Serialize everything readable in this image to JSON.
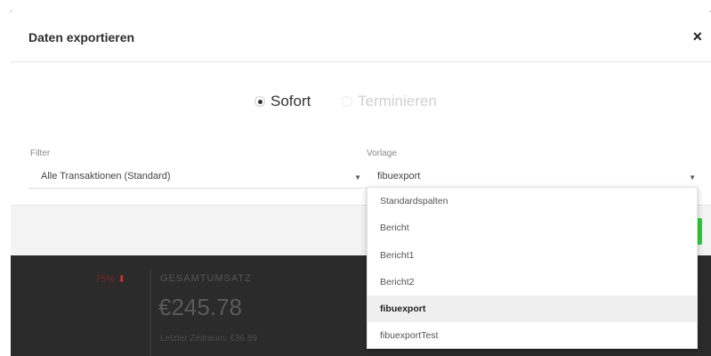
{
  "background": {
    "kpi_change": "75%",
    "kpi_label": "GESAMTUMSATZ",
    "kpi_value": "€245.78",
    "kpi_sub": "Letzter Zeitraum: €36.89"
  },
  "modal": {
    "title": "Daten exportieren",
    "close_symbol": "×",
    "modes": [
      {
        "label": "Sofort",
        "checked": true
      },
      {
        "label": "Terminieren",
        "checked": false
      }
    ],
    "filter": {
      "label": "Filter",
      "value": "Alle Transaktionen (Standard)"
    },
    "template": {
      "label": "Vorlage",
      "value": "fibuexport",
      "options": [
        "Standardspalten",
        "Bericht",
        "Bericht1",
        "Bericht2",
        "fibuexport",
        "fibuexportTest"
      ],
      "selected_option": "fibuexport"
    }
  },
  "colors": {
    "accent_button": "#2ecc40",
    "kpi_down": "#c0392b"
  }
}
